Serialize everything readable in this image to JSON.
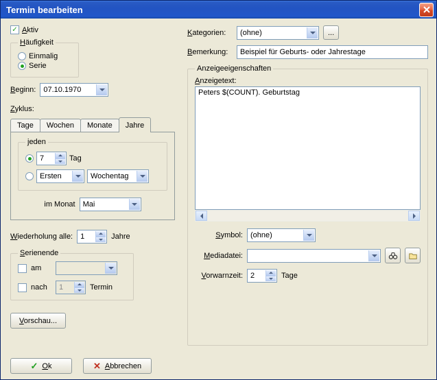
{
  "window": {
    "title": "Termin bearbeiten"
  },
  "aktiv": {
    "label": "Aktiv",
    "checked": true
  },
  "haeufigkeit": {
    "legend": "Häufigkeit",
    "einmalig": "Einmalig",
    "serie": "Serie",
    "selected": "serie"
  },
  "beginn": {
    "label": "Beginn:",
    "value": "07.10.1970"
  },
  "zyklus": {
    "label": "Zyklus:",
    "tabs": {
      "tage": "Tage",
      "wochen": "Wochen",
      "monate": "Monate",
      "jahre": "Jahre"
    },
    "jeden": {
      "legend": "jeden",
      "day_value": "7",
      "day_suffix": "Tag",
      "ordinal_options": [
        "Ersten"
      ],
      "ordinal_value": "Ersten",
      "weekday_options": [
        "Wochentag"
      ],
      "weekday_value": "Wochentag",
      "selected": "day"
    },
    "im_monat": {
      "label": "im Monat",
      "value": "Mai"
    }
  },
  "wiederholung": {
    "label": "Wiederholung alle:",
    "value": "1",
    "suffix": "Jahre"
  },
  "serienende": {
    "legend": "Serienende",
    "am": {
      "label": "am",
      "value": ""
    },
    "nach": {
      "label": "nach",
      "value": "1",
      "suffix": "Termin"
    }
  },
  "vorschau": {
    "label": "Vorschau..."
  },
  "kategorien": {
    "label": "Kategorien:",
    "value": "(ohne)"
  },
  "bemerkung": {
    "label": "Bemerkung:",
    "value": "Beispiel für Geburts- oder Jahrestage"
  },
  "anzeige": {
    "legend": "Anzeigeeigenschaften",
    "anzeigetext": {
      "label": "Anzeigetext:",
      "value": "Peters $(COUNT). Geburtstag"
    },
    "symbol": {
      "label": "Symbol:",
      "value": "(ohne)"
    },
    "mediadatei": {
      "label": "Mediadatei:",
      "value": ""
    },
    "vorwarnzeit": {
      "label": "Vorwarnzeit:",
      "value": "2",
      "suffix": "Tage"
    }
  },
  "buttons": {
    "ok": "Ok",
    "cancel": "Abbrechen",
    "ellipsis": "..."
  }
}
